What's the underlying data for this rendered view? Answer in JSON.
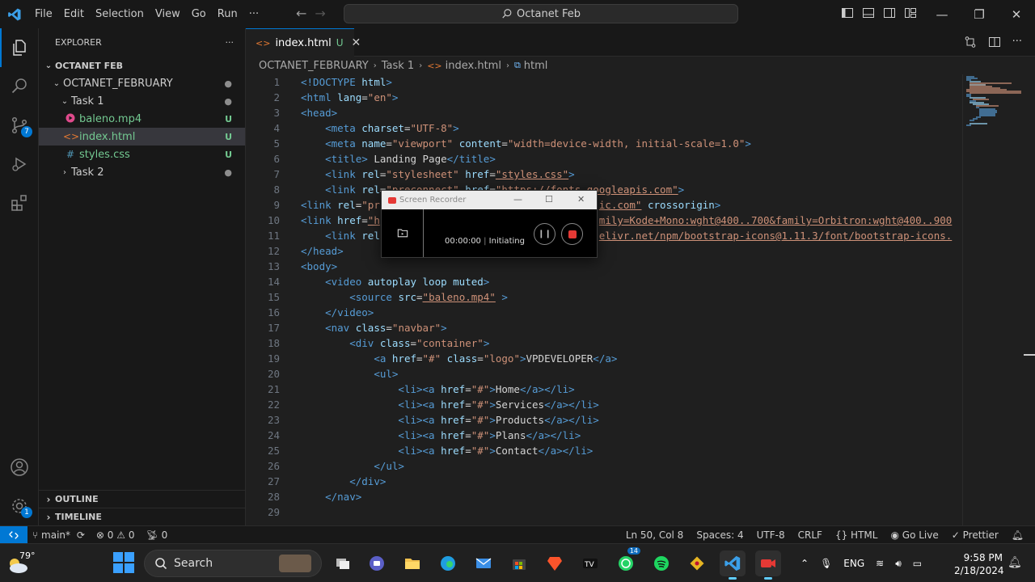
{
  "titlebar": {
    "menu": [
      "File",
      "Edit",
      "Selection",
      "View",
      "Go",
      "Run",
      "···"
    ],
    "command_center": "Octanet Feb"
  },
  "activity": {
    "source_control_badge": "7",
    "manage_badge": "1"
  },
  "sidebar": {
    "title": "EXPLORER",
    "more": "···",
    "workspace": "OCTANET FEB",
    "tree": [
      {
        "label": "OCTANET_FEBRUARY",
        "type": "folder",
        "deco": "●"
      },
      {
        "label": "Task 1",
        "type": "folder",
        "deco": "●"
      },
      {
        "label": "baleno.mp4",
        "type": "file",
        "deco": "U"
      },
      {
        "label": "index.html",
        "type": "file",
        "deco": "U"
      },
      {
        "label": "styles.css",
        "type": "file",
        "deco": "U"
      },
      {
        "label": "Task 2",
        "type": "folder",
        "deco": "●"
      }
    ],
    "outline": "OUTLINE",
    "timeline": "TIMELINE"
  },
  "tab": {
    "label": "index.html",
    "status": "U",
    "close": "✕"
  },
  "breadcrumb": [
    "OCTANET_FEBRUARY",
    "Task 1",
    "index.html",
    "html"
  ],
  "code_lines": [
    [
      [
        "t",
        "<!DOCTYPE "
      ],
      [
        "a",
        "html"
      ],
      [
        "t",
        ">"
      ]
    ],
    [
      [
        "t",
        "<html "
      ],
      [
        "a",
        "lang"
      ],
      [
        "x",
        "="
      ],
      [
        "s",
        "\"en\""
      ],
      [
        "t",
        ">"
      ]
    ],
    [
      [
        "t",
        "<head>"
      ]
    ],
    [
      [
        "x",
        "    "
      ],
      [
        "t",
        "<meta "
      ],
      [
        "a",
        "charset"
      ],
      [
        "x",
        "="
      ],
      [
        "s",
        "\"UTF-8\""
      ],
      [
        "t",
        ">"
      ]
    ],
    [
      [
        "x",
        "    "
      ],
      [
        "t",
        "<meta "
      ],
      [
        "a",
        "name"
      ],
      [
        "x",
        "="
      ],
      [
        "s",
        "\"viewport\""
      ],
      [
        "x",
        " "
      ],
      [
        "a",
        "content"
      ],
      [
        "x",
        "="
      ],
      [
        "s",
        "\"width=device-width, initial-scale=1.0\""
      ],
      [
        "t",
        ">"
      ]
    ],
    [
      [
        "x",
        "    "
      ],
      [
        "t",
        "<title>"
      ],
      [
        "x",
        " Landing Page"
      ],
      [
        "t",
        "</title>"
      ]
    ],
    [
      [
        "x",
        "    "
      ],
      [
        "t",
        "<link "
      ],
      [
        "a",
        "rel"
      ],
      [
        "x",
        "="
      ],
      [
        "s",
        "\"stylesheet\""
      ],
      [
        "x",
        " "
      ],
      [
        "a",
        "href"
      ],
      [
        "x",
        "="
      ],
      [
        "su",
        "\"styles.css\""
      ],
      [
        "t",
        ">"
      ]
    ],
    [
      [
        "x",
        "    "
      ],
      [
        "t",
        "<link "
      ],
      [
        "a",
        "rel"
      ],
      [
        "x",
        "="
      ],
      [
        "s",
        "\"preconnect\""
      ],
      [
        "x",
        " "
      ],
      [
        "a",
        "href"
      ],
      [
        "x",
        "="
      ],
      [
        "su",
        "\"https://fonts.googleapis.com\""
      ],
      [
        "t",
        ">"
      ]
    ],
    [
      [
        "t",
        "<link "
      ],
      [
        "a",
        "rel"
      ],
      [
        "x",
        "="
      ],
      [
        "s",
        "\"pr"
      ],
      [
        "x",
        "                                    "
      ],
      [
        "su",
        "ic.com\""
      ],
      [
        "x",
        " "
      ],
      [
        "a",
        "crossorigin"
      ],
      [
        "t",
        ">"
      ]
    ],
    [
      [
        "t",
        "<link "
      ],
      [
        "a",
        "href"
      ],
      [
        "x",
        "="
      ],
      [
        "su",
        "\"h"
      ],
      [
        "x",
        "                                    "
      ],
      [
        "su",
        "mily=Kode+Mono:wght@400..700&family=Orbitron:wght@400..900"
      ]
    ],
    [
      [
        "x",
        "    "
      ],
      [
        "t",
        "<link "
      ],
      [
        "a",
        "rel"
      ],
      [
        "x",
        "                                    "
      ],
      [
        "su",
        "elivr.net/npm/bootstrap-icons@1.11.3/font/bootstrap-icons."
      ]
    ],
    [
      [
        "t",
        "</head>"
      ]
    ],
    [
      [
        "t",
        "<body>"
      ]
    ],
    [
      [
        "x",
        "    "
      ],
      [
        "t",
        "<video "
      ],
      [
        "a",
        "autoplay loop muted"
      ],
      [
        "t",
        ">"
      ]
    ],
    [
      [
        "x",
        "        "
      ],
      [
        "t",
        "<source "
      ],
      [
        "a",
        "src"
      ],
      [
        "x",
        "="
      ],
      [
        "su",
        "\"baleno.mp4\""
      ],
      [
        "x",
        " "
      ],
      [
        "t",
        ">"
      ]
    ],
    [
      [
        "x",
        "    "
      ],
      [
        "t",
        "</video>"
      ]
    ],
    [
      [
        "x",
        "    "
      ],
      [
        "t",
        "<nav "
      ],
      [
        "a",
        "class"
      ],
      [
        "x",
        "="
      ],
      [
        "s",
        "\"navbar\""
      ],
      [
        "t",
        ">"
      ]
    ],
    [
      [
        "x",
        "        "
      ],
      [
        "t",
        "<div "
      ],
      [
        "a",
        "class"
      ],
      [
        "x",
        "="
      ],
      [
        "s",
        "\"container\""
      ],
      [
        "t",
        ">"
      ]
    ],
    [
      [
        "x",
        "            "
      ],
      [
        "t",
        "<a "
      ],
      [
        "a",
        "href"
      ],
      [
        "x",
        "="
      ],
      [
        "s",
        "\"#\""
      ],
      [
        "x",
        " "
      ],
      [
        "a",
        "class"
      ],
      [
        "x",
        "="
      ],
      [
        "s",
        "\"logo\""
      ],
      [
        "t",
        ">"
      ],
      [
        "x",
        "VPDEVELOPER"
      ],
      [
        "t",
        "</a>"
      ]
    ],
    [
      [
        "x",
        "            "
      ],
      [
        "t",
        "<ul>"
      ]
    ],
    [
      [
        "x",
        "                "
      ],
      [
        "t",
        "<li><a "
      ],
      [
        "a",
        "href"
      ],
      [
        "x",
        "="
      ],
      [
        "s",
        "\"#\""
      ],
      [
        "t",
        ">"
      ],
      [
        "x",
        "Home"
      ],
      [
        "t",
        "</a></li>"
      ]
    ],
    [
      [
        "x",
        "                "
      ],
      [
        "t",
        "<li><a "
      ],
      [
        "a",
        "href"
      ],
      [
        "x",
        "="
      ],
      [
        "s",
        "\"#\""
      ],
      [
        "t",
        ">"
      ],
      [
        "x",
        "Services"
      ],
      [
        "t",
        "</a></li>"
      ]
    ],
    [
      [
        "x",
        "                "
      ],
      [
        "t",
        "<li><a "
      ],
      [
        "a",
        "href"
      ],
      [
        "x",
        "="
      ],
      [
        "s",
        "\"#\""
      ],
      [
        "t",
        ">"
      ],
      [
        "x",
        "Products"
      ],
      [
        "t",
        "</a></li>"
      ]
    ],
    [
      [
        "x",
        "                "
      ],
      [
        "t",
        "<li><a "
      ],
      [
        "a",
        "href"
      ],
      [
        "x",
        "="
      ],
      [
        "s",
        "\"#\""
      ],
      [
        "t",
        ">"
      ],
      [
        "x",
        "Plans"
      ],
      [
        "t",
        "</a></li>"
      ]
    ],
    [
      [
        "x",
        "                "
      ],
      [
        "t",
        "<li><a "
      ],
      [
        "a",
        "href"
      ],
      [
        "x",
        "="
      ],
      [
        "s",
        "\"#\""
      ],
      [
        "t",
        ">"
      ],
      [
        "x",
        "Contact"
      ],
      [
        "t",
        "</a></li>"
      ]
    ],
    [
      [
        "x",
        "            "
      ],
      [
        "t",
        "</ul>"
      ]
    ],
    [
      [
        "x",
        "        "
      ],
      [
        "t",
        "</div>"
      ]
    ],
    [
      [
        "x",
        "    "
      ],
      [
        "t",
        "</nav>"
      ]
    ],
    [
      [
        "x",
        ""
      ]
    ]
  ],
  "recorder": {
    "title": "Screen Recorder",
    "time": "00:00:00",
    "state": "Initiating"
  },
  "status": {
    "branch": "main*",
    "errors": "0",
    "warnings": "0",
    "ports": "0",
    "position": "Ln 50, Col 8",
    "spaces": "Spaces: 4",
    "encoding": "UTF-8",
    "eol": "CRLF",
    "language": "HTML",
    "golive": "Go Live",
    "prettier": "Prettier"
  },
  "taskbar": {
    "temperature": "79°",
    "search": "Search",
    "whatsapp_badge": "14",
    "language": "ENG",
    "time": "9:58 PM",
    "date": "2/18/2024"
  },
  "colors": {
    "accent": "#0078d4",
    "untracked": "#73c991",
    "tag": "#569cd6",
    "attr": "#9cdcfe",
    "string": "#ce9178"
  }
}
